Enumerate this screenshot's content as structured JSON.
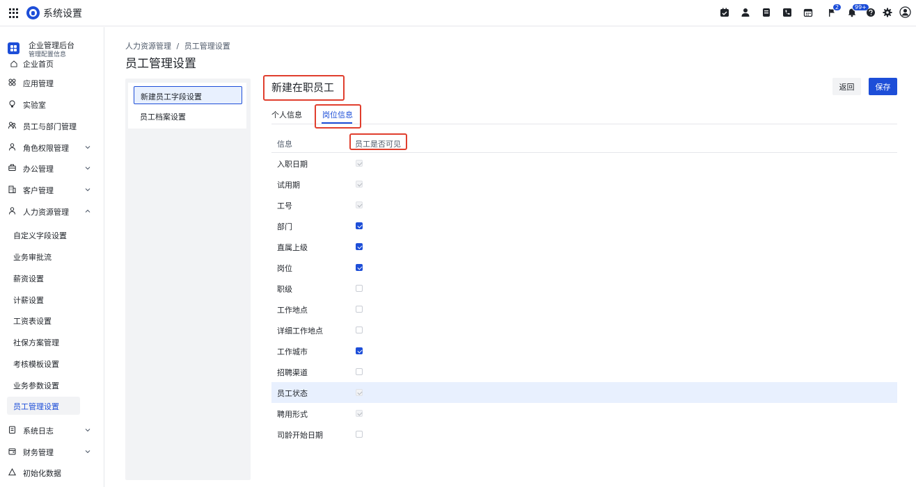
{
  "app": {
    "title": "系统设置"
  },
  "topbar": {
    "badges": {
      "flag": "2",
      "bell": "99+"
    },
    "icons": [
      "tasks-icon",
      "user-icon",
      "document-icon",
      "phone-icon",
      "calendar-icon",
      "flag-icon",
      "bell-icon",
      "help-icon",
      "gear-icon",
      "avatar-icon"
    ]
  },
  "sidebar": {
    "org": {
      "name": "企业管理后台",
      "sub": "管理配置信息"
    },
    "ghost_label": "企业首页",
    "items": [
      {
        "label": "应用管理"
      },
      {
        "label": "实验室"
      },
      {
        "label": "员工与部门管理"
      },
      {
        "label": "角色权限管理"
      },
      {
        "label": "办公管理"
      },
      {
        "label": "客户管理"
      },
      {
        "label": "人力资源管理"
      }
    ],
    "sub_items": [
      {
        "label": "自定义字段设置"
      },
      {
        "label": "业务审批流"
      },
      {
        "label": "薪资设置"
      },
      {
        "label": "计薪设置"
      },
      {
        "label": "工资表设置"
      },
      {
        "label": "社保方案管理"
      },
      {
        "label": "考核模板设置"
      },
      {
        "label": "业务参数设置"
      },
      {
        "label": "员工管理设置"
      }
    ],
    "bottom_items": [
      {
        "label": "系统日志"
      },
      {
        "label": "财务管理"
      },
      {
        "label": "初始化数据"
      }
    ]
  },
  "breadcrumb": [
    "人力资源管理",
    "/",
    "员工管理设置"
  ],
  "page_title": "员工管理设置",
  "left_menu": [
    "新建员工字段设置",
    "员工档案设置"
  ],
  "section": {
    "title": "新建在职员工",
    "back_label": "返回",
    "save_label": "保存",
    "tabs": [
      "个人信息",
      "岗位信息"
    ]
  },
  "table": {
    "col_info": "信息",
    "col_visible": "员工是否可见",
    "rows": [
      {
        "label": "入职日期",
        "state": "locked"
      },
      {
        "label": "试用期",
        "state": "locked"
      },
      {
        "label": "工号",
        "state": "locked"
      },
      {
        "label": "部门",
        "state": "checked"
      },
      {
        "label": "直属上级",
        "state": "checked"
      },
      {
        "label": "岗位",
        "state": "checked"
      },
      {
        "label": "职级",
        "state": "unchecked"
      },
      {
        "label": "工作地点",
        "state": "unchecked"
      },
      {
        "label": "详细工作地点",
        "state": "unchecked"
      },
      {
        "label": "工作城市",
        "state": "checked"
      },
      {
        "label": "招聘渠道",
        "state": "unchecked"
      },
      {
        "label": "员工状态",
        "state": "locked"
      },
      {
        "label": "聘用形式",
        "state": "locked"
      },
      {
        "label": "司龄开始日期",
        "state": "unchecked"
      }
    ]
  },
  "colors": {
    "accent": "#1d4ed8",
    "highlight": "#e8f0fe",
    "annotation": "#e03e2d"
  }
}
